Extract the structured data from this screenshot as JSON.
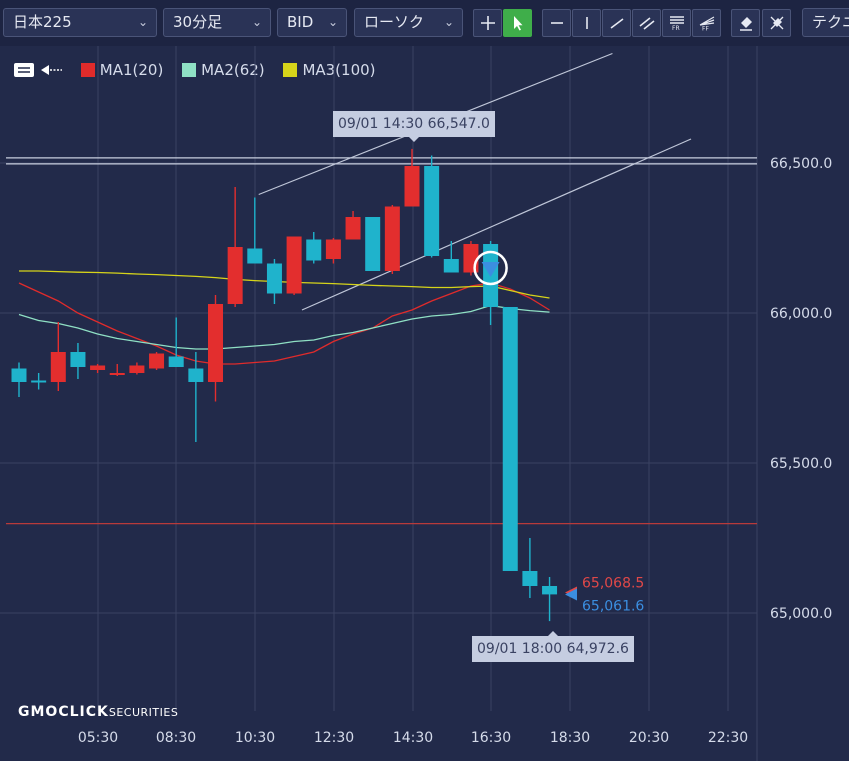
{
  "toolbar": {
    "instrument": "日本225",
    "timeframe": "30分足",
    "price_type": "BID",
    "chart_style": "ローソク",
    "technical_label": "テクニ"
  },
  "legend": [
    {
      "label": "MA1(20)",
      "color": "#e02b2b"
    },
    {
      "label": "MA2(62)",
      "color": "#8fe0c4"
    },
    {
      "label": "MA3(100)",
      "color": "#d6d41a"
    }
  ],
  "tooltips": {
    "high": "09/01 14:30 66,547.0",
    "low": "09/01 18:00 64,972.6"
  },
  "price_tags": {
    "ask": "65,068.5",
    "bid": "65,061.6"
  },
  "brand": {
    "main": "GMOCLICK",
    "sub": "SECURITIES"
  },
  "colors": {
    "up": "#e32e2e",
    "down": "#1fb3cc",
    "ask": "#e04848",
    "bid": "#3b8ee0",
    "grid": "#3a4262"
  },
  "chart_data": {
    "type": "candlestick",
    "ylim": [
      64640,
      66990
    ],
    "y_ticks": [
      "66,500.0",
      "66,000.0",
      "65,500.0",
      "65,000.0"
    ],
    "y_tick_values": [
      66500,
      66000,
      65500,
      65000
    ],
    "x_ticks": [
      "05:30",
      "08:30",
      "10:30",
      "12:30",
      "14:30",
      "16:30",
      "18:30",
      "20:30",
      "22:30"
    ],
    "candles": [
      {
        "o": 65815,
        "h": 65835,
        "l": 65720,
        "c": 65770
      },
      {
        "o": 65775,
        "h": 65800,
        "l": 65745,
        "c": 65770
      },
      {
        "o": 65770,
        "h": 65970,
        "l": 65740,
        "c": 65870
      },
      {
        "o": 65870,
        "h": 65900,
        "l": 65780,
        "c": 65820
      },
      {
        "o": 65810,
        "h": 65830,
        "l": 65800,
        "c": 65825
      },
      {
        "o": 65800,
        "h": 65830,
        "l": 65790,
        "c": 65800
      },
      {
        "o": 65800,
        "h": 65835,
        "l": 65795,
        "c": 65825
      },
      {
        "o": 65815,
        "h": 65870,
        "l": 65810,
        "c": 65865
      },
      {
        "o": 65855,
        "h": 65985,
        "l": 65830,
        "c": 65820
      },
      {
        "o": 65815,
        "h": 65870,
        "l": 65570,
        "c": 65770
      },
      {
        "o": 65770,
        "h": 66060,
        "l": 65705,
        "c": 66030
      },
      {
        "o": 66030,
        "h": 66420,
        "l": 66020,
        "c": 66220
      },
      {
        "o": 66215,
        "h": 66385,
        "l": 66165,
        "c": 66165
      },
      {
        "o": 66165,
        "h": 66180,
        "l": 66030,
        "c": 66065
      },
      {
        "o": 66065,
        "h": 66255,
        "l": 66060,
        "c": 66255
      },
      {
        "o": 66245,
        "h": 66270,
        "l": 66165,
        "c": 66175
      },
      {
        "o": 66180,
        "h": 66250,
        "l": 66165,
        "c": 66245
      },
      {
        "o": 66245,
        "h": 66340,
        "l": 66245,
        "c": 66320
      },
      {
        "o": 66320,
        "h": 66320,
        "l": 66145,
        "c": 66140
      },
      {
        "o": 66140,
        "h": 66360,
        "l": 66130,
        "c": 66355
      },
      {
        "o": 66355,
        "h": 66547,
        "l": 66355,
        "c": 66490
      },
      {
        "o": 66490,
        "h": 66525,
        "l": 66185,
        "c": 66190
      },
      {
        "o": 66180,
        "h": 66240,
        "l": 66140,
        "c": 66135
      },
      {
        "o": 66135,
        "h": 66240,
        "l": 66125,
        "c": 66230
      },
      {
        "o": 66230,
        "h": 66240,
        "l": 65960,
        "c": 66020
      },
      {
        "o": 66020,
        "h": 66020,
        "l": 65140,
        "c": 65140
      },
      {
        "o": 65140,
        "h": 65250,
        "l": 65050,
        "c": 65090
      },
      {
        "o": 65090,
        "h": 65120,
        "l": 64973,
        "c": 65062
      }
    ],
    "ma": [
      {
        "name": "MA1(20)",
        "color": "#e02b2b",
        "values": [
          66100,
          66070,
          66040,
          66000,
          65970,
          65940,
          65915,
          65890,
          65860,
          65840,
          65830,
          65830,
          65835,
          65840,
          65855,
          65870,
          65905,
          65930,
          65950,
          65990,
          66010,
          66040,
          66065,
          66090,
          66100,
          66080,
          66050,
          66010
        ]
      },
      {
        "name": "MA2(62)",
        "color": "#8fe0c4",
        "values": [
          65995,
          65975,
          65965,
          65950,
          65930,
          65915,
          65905,
          65895,
          65885,
          65880,
          65880,
          65885,
          65890,
          65895,
          65905,
          65910,
          65925,
          65935,
          65950,
          65965,
          65980,
          65990,
          65995,
          66005,
          66025,
          66015,
          66008,
          66003
        ]
      },
      {
        "name": "MA3(100)",
        "color": "#d6d41a",
        "values": [
          66140,
          66140,
          66138,
          66136,
          66135,
          66133,
          66130,
          66128,
          66125,
          66122,
          66118,
          66112,
          66108,
          66105,
          66102,
          66100,
          66098,
          66095,
          66092,
          66090,
          66088,
          66085,
          66085,
          66088,
          66090,
          66075,
          66060,
          66050
        ]
      }
    ],
    "channel_lines": [
      {
        "x0": 12.2,
        "y0": 66395,
        "x1": 30.2,
        "y1": 66865
      },
      {
        "x0": 14.4,
        "y0": 66010,
        "x1": 34.2,
        "y1": 66580
      }
    ],
    "horizontal_lines": [
      {
        "value": 66517,
        "color": "#c8cede"
      },
      {
        "value": 66497,
        "color": "#c8cede"
      },
      {
        "value": 65298,
        "color": "#b83a3a"
      }
    ],
    "signal_marker": {
      "index": 24,
      "value": 66150
    },
    "last": {
      "ask": 65068.5,
      "bid": 65061.6
    }
  }
}
